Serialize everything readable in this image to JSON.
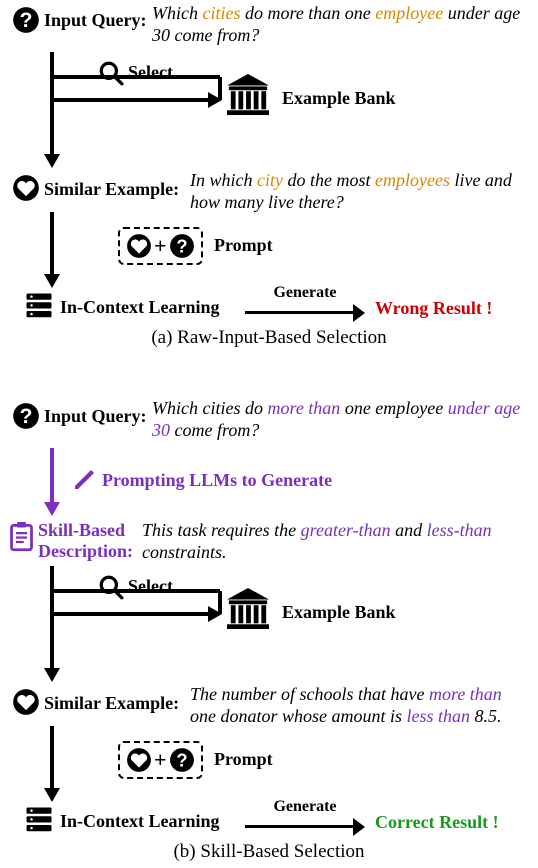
{
  "panel_a": {
    "input_query_label": "Input Query:",
    "input_query_pre1": "Which ",
    "input_query_hl1": "cities",
    "input_query_mid1": " do more than one ",
    "input_query_hl2": "employee",
    "input_query_post1": " under age 30 come from?",
    "select_label": "Select",
    "example_bank_label": "Example Bank",
    "similar_example_label": "Similar Example:",
    "similar_pre1": "In which ",
    "similar_hl1": "city",
    "similar_mid1": " do the most ",
    "similar_hl2": "employees",
    "similar_post1": " live and how many live there?",
    "prompt_label": "Prompt",
    "in_context_label": "In-Context Learning",
    "generate_label": "Generate",
    "wrong_result": "Wrong Result !",
    "caption": "(a) Raw-Input-Based Selection"
  },
  "panel_b": {
    "input_query_label": "Input Query:",
    "input_query_pre1": "Which cities do ",
    "input_query_hl1": "more than",
    "input_query_mid1": " one employee ",
    "input_query_hl2": "under age 30",
    "input_query_post1": " come from?",
    "prompting_label": "Prompting LLMs to Generate",
    "skill_label_line1": "Skill-Based",
    "skill_label_line2": "Description:",
    "skill_pre1": "This task requires the ",
    "skill_hl1": "greater-than",
    "skill_mid1": " and ",
    "skill_hl2": "less-than",
    "skill_post1": " constraints.",
    "select_label": "Select",
    "example_bank_label": "Example Bank",
    "similar_example_label": "Similar Example:",
    "similar_pre1": "The number of schools that have ",
    "similar_hl1": "more than",
    "similar_mid1": " one donator whose amount is ",
    "similar_hl2": "less than",
    "similar_post1": " 8.5.",
    "prompt_label": "Prompt",
    "in_context_label": "In-Context Learning",
    "generate_label": "Generate",
    "correct_result": "Correct Result !",
    "caption": "(b) Skill-Based Selection"
  },
  "icons": {
    "question": "question-mark-icon",
    "search": "search-icon",
    "bank": "bank-icon",
    "heart": "heart-icon",
    "server": "server-icon",
    "pencil": "pencil-icon",
    "clipboard": "clipboard-icon"
  }
}
